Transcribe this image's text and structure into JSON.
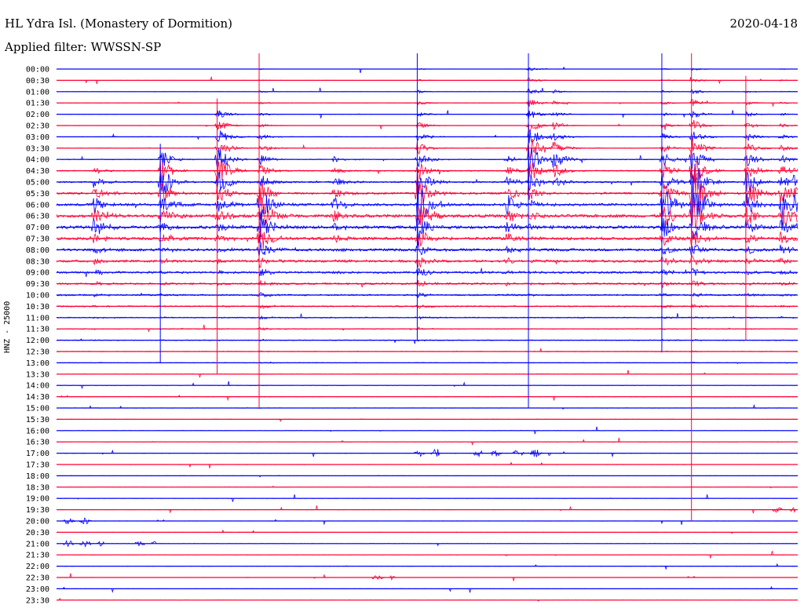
{
  "header": {
    "station": "HL Ydra Isl. (Monastery of Dormition)",
    "filter_label": "Applied filter: WWSSN-SP",
    "date": "2020-04-18"
  },
  "chart_data": {
    "type": "line",
    "chart_kind": "helicorder",
    "channel_label": "HNZ - 25000",
    "colors": {
      "odd_rows": "#0000ff",
      "even_rows": "#ff0033"
    },
    "minutes_per_row": 30,
    "rows": [
      "00:00",
      "00:30",
      "01:00",
      "01:30",
      "02:00",
      "02:30",
      "03:00",
      "03:30",
      "04:00",
      "04:30",
      "05:00",
      "05:30",
      "06:00",
      "06:30",
      "07:00",
      "07:30",
      "08:00",
      "08:30",
      "09:00",
      "09:30",
      "10:00",
      "10:30",
      "11:00",
      "11:30",
      "12:00",
      "12:30",
      "13:00",
      "13:30",
      "14:00",
      "14:30",
      "15:00",
      "15:30",
      "16:00",
      "16:30",
      "17:00",
      "17:30",
      "18:00",
      "18:30",
      "19:00",
      "19:30",
      "20:00",
      "20:30",
      "21:00",
      "21:30",
      "22:00",
      "22:30",
      "23:00",
      "23:30"
    ],
    "row_noise_level": [
      0.02,
      0.03,
      0.03,
      0.03,
      0.03,
      0.05,
      0.07,
      0.09,
      0.12,
      0.16,
      0.22,
      0.3,
      0.38,
      0.45,
      0.45,
      0.42,
      0.38,
      0.34,
      0.3,
      0.26,
      0.22,
      0.18,
      0.15,
      0.12,
      0.12,
      0.1,
      0.09,
      0.08,
      0.07,
      0.07,
      0.07,
      0.06,
      0.06,
      0.06,
      0.06,
      0.05,
      0.05,
      0.05,
      0.05,
      0.05,
      0.05,
      0.05,
      0.05,
      0.04,
      0.04,
      0.04,
      0.04,
      0.04
    ],
    "events": [
      {
        "minute": 1.5,
        "row_start": 9,
        "row_end": 24,
        "peak_row": 13,
        "amplitude": 4.0,
        "kind": "regional"
      },
      {
        "minute": 4.2,
        "row_start": 8,
        "row_end": 26,
        "peak_row": 10,
        "amplitude": 6.0,
        "kind": "regional"
      },
      {
        "minute": 6.5,
        "row_start": 4,
        "row_end": 27,
        "peak_row": 9,
        "amplitude": 6.5,
        "kind": "regional"
      },
      {
        "minute": 8.2,
        "row_start": 0,
        "row_end": 30,
        "peak_row": 13,
        "amplitude": 8.0,
        "kind": "regional"
      },
      {
        "minute": 11.2,
        "row_start": 8,
        "row_end": 18,
        "peak_row": 12,
        "amplitude": 3.0,
        "kind": "regional"
      },
      {
        "minute": 14.6,
        "row_start": 0,
        "row_end": 24,
        "peak_row": 12,
        "amplitude": 9.0,
        "kind": "regional"
      },
      {
        "minute": 18.2,
        "row_start": 8,
        "row_end": 20,
        "peak_row": 12,
        "amplitude": 4.0,
        "kind": "regional"
      },
      {
        "minute": 19.1,
        "row_start": 0,
        "row_end": 30,
        "peak_row": 8,
        "amplitude": 6.0,
        "kind": "regional"
      },
      {
        "minute": 20.1,
        "row_start": 2,
        "row_end": 10,
        "peak_row": 8,
        "amplitude": 3.5,
        "kind": "regional"
      },
      {
        "minute": 24.5,
        "row_start": 0,
        "row_end": 25,
        "peak_row": 12,
        "amplitude": 7.0,
        "kind": "regional"
      },
      {
        "minute": 25.7,
        "row_start": 0,
        "row_end": 40,
        "peak_row": 11,
        "amplitude": 12.0,
        "kind": "regional"
      },
      {
        "minute": 27.9,
        "row_start": 2,
        "row_end": 24,
        "peak_row": 11,
        "amplitude": 6.0,
        "kind": "regional"
      },
      {
        "minute": 29.3,
        "row_start": 0,
        "row_end": 22,
        "peak_row": 12,
        "amplitude": 5.0,
        "kind": "regional"
      },
      {
        "minute": 29.8,
        "row_start": 9,
        "row_end": 14,
        "peak_row": 12,
        "amplitude": 3.5,
        "kind": "regional"
      },
      {
        "minute": 14.5,
        "row_start": 34,
        "row_end": 34,
        "peak_row": 34,
        "amplitude": 1.4,
        "kind": "tremor",
        "duration": 1.0
      },
      {
        "minute": 16.9,
        "row_start": 34,
        "row_end": 34,
        "peak_row": 34,
        "amplitude": 1.0,
        "kind": "tremor",
        "duration": 0.4
      },
      {
        "minute": 17.6,
        "row_start": 34,
        "row_end": 34,
        "peak_row": 34,
        "amplitude": 1.0,
        "kind": "tremor",
        "duration": 0.5
      },
      {
        "minute": 18.5,
        "row_start": 34,
        "row_end": 34,
        "peak_row": 34,
        "amplitude": 1.2,
        "kind": "tremor",
        "duration": 1.5
      },
      {
        "minute": 0.3,
        "row_start": 40,
        "row_end": 40,
        "peak_row": 40,
        "amplitude": 1.0,
        "kind": "tremor",
        "duration": 1.3
      },
      {
        "minute": 0.3,
        "row_start": 42,
        "row_end": 42,
        "peak_row": 42,
        "amplitude": 1.0,
        "kind": "tremor",
        "duration": 1.6
      },
      {
        "minute": 3.2,
        "row_start": 42,
        "row_end": 42,
        "peak_row": 42,
        "amplitude": 0.9,
        "kind": "tremor",
        "duration": 0.8
      },
      {
        "minute": 12.8,
        "row_start": 45,
        "row_end": 45,
        "peak_row": 45,
        "amplitude": 0.9,
        "kind": "tremor",
        "duration": 0.9
      },
      {
        "minute": 29.0,
        "row_start": 39,
        "row_end": 39,
        "peak_row": 39,
        "amplitude": 0.8,
        "kind": "tremor",
        "duration": 0.9
      }
    ]
  }
}
